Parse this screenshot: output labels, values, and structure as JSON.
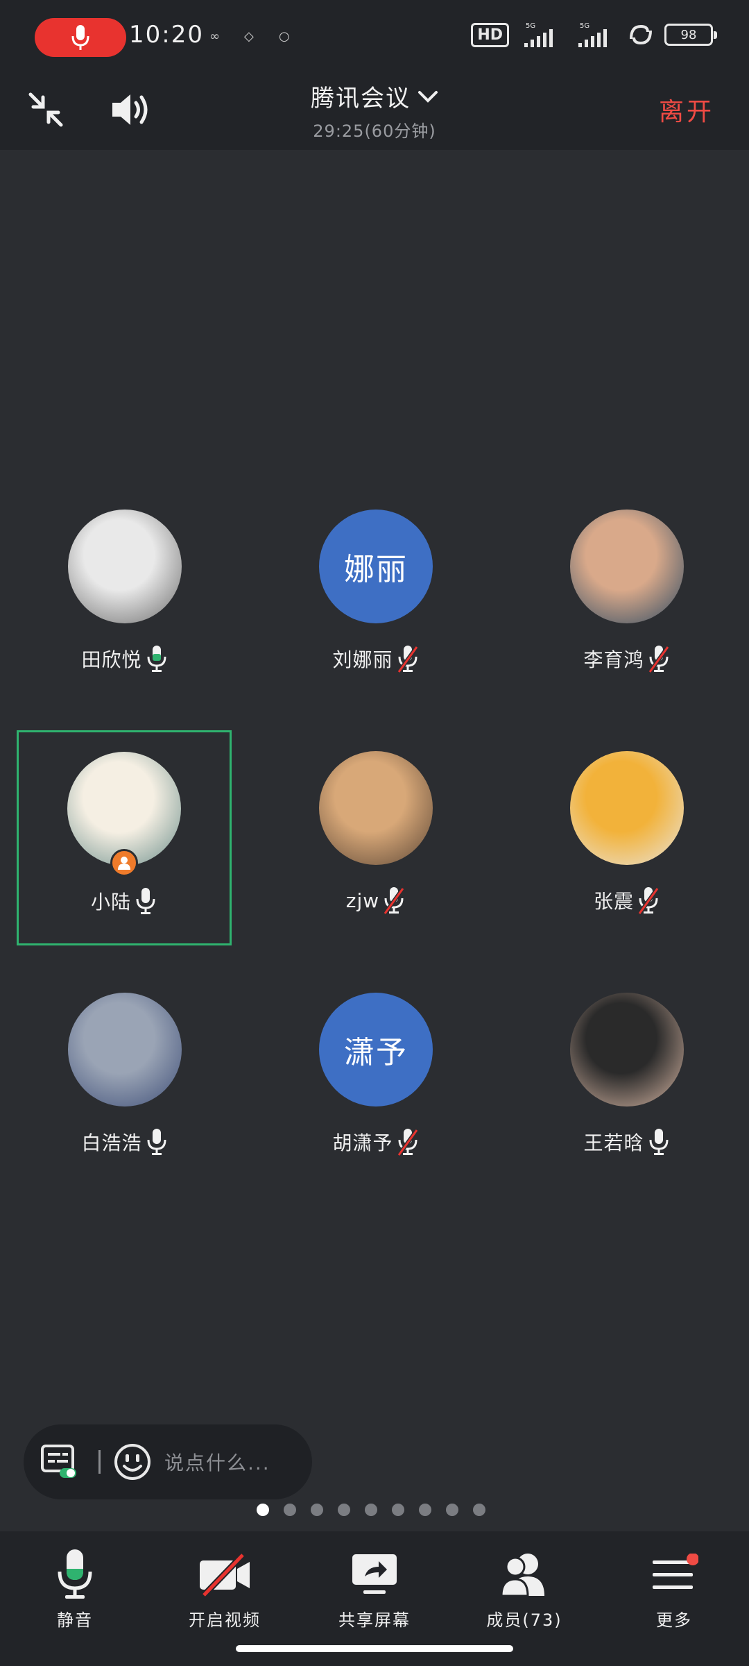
{
  "status_bar": {
    "time": "10:20",
    "network": "5G",
    "hd_label": "HD",
    "battery": "98"
  },
  "header": {
    "title": "腾讯会议",
    "subtitle": "29:25(60分钟)",
    "leave_label": "离开"
  },
  "participants": [
    {
      "name": "田欣悦",
      "mic": "on",
      "avatar": "photo",
      "colors": [
        "#e9e9e9",
        "#6a6a6a"
      ]
    },
    {
      "name": "刘娜丽",
      "mic": "muted",
      "avatar": "text",
      "avatar_text": "娜丽"
    },
    {
      "name": "李育鸿",
      "mic": "muted",
      "avatar": "photo",
      "colors": [
        "#d9a98a",
        "#2c4a63"
      ]
    },
    {
      "name": "小陆",
      "mic": "off",
      "avatar": "photo",
      "colors": [
        "#f5efe3",
        "#6a8d8a"
      ]
    },
    {
      "name": "zjw",
      "mic": "muted",
      "avatar": "photo",
      "colors": [
        "#d8a878",
        "#5b4636"
      ]
    },
    {
      "name": "张震",
      "mic": "muted",
      "avatar": "photo",
      "colors": [
        "#f2b23a",
        "#e8e4dd"
      ]
    },
    {
      "name": "白浩浩",
      "mic": "off",
      "avatar": "photo",
      "colors": [
        "#9aa4b5",
        "#3f4f78"
      ]
    },
    {
      "name": "胡潇予",
      "mic": "muted",
      "avatar": "text",
      "avatar_text": "潇予"
    },
    {
      "name": "王若晗",
      "mic": "off",
      "avatar": "photo",
      "colors": [
        "#2a2a2a",
        "#d9b8a5"
      ]
    }
  ],
  "chat": {
    "placeholder": "说点什么..."
  },
  "pager": {
    "total": 9,
    "current": 1
  },
  "toolbar": {
    "mute_label": "静音",
    "video_label": "开启视频",
    "share_label": "共享屏幕",
    "members_label": "成员(73)",
    "more_label": "更多"
  },
  "colors": {
    "accent_green": "#2fb36f",
    "leave_red": "#f04b44",
    "avatar_blue": "#3e6fc4",
    "host_orange": "#ef7b2b"
  }
}
